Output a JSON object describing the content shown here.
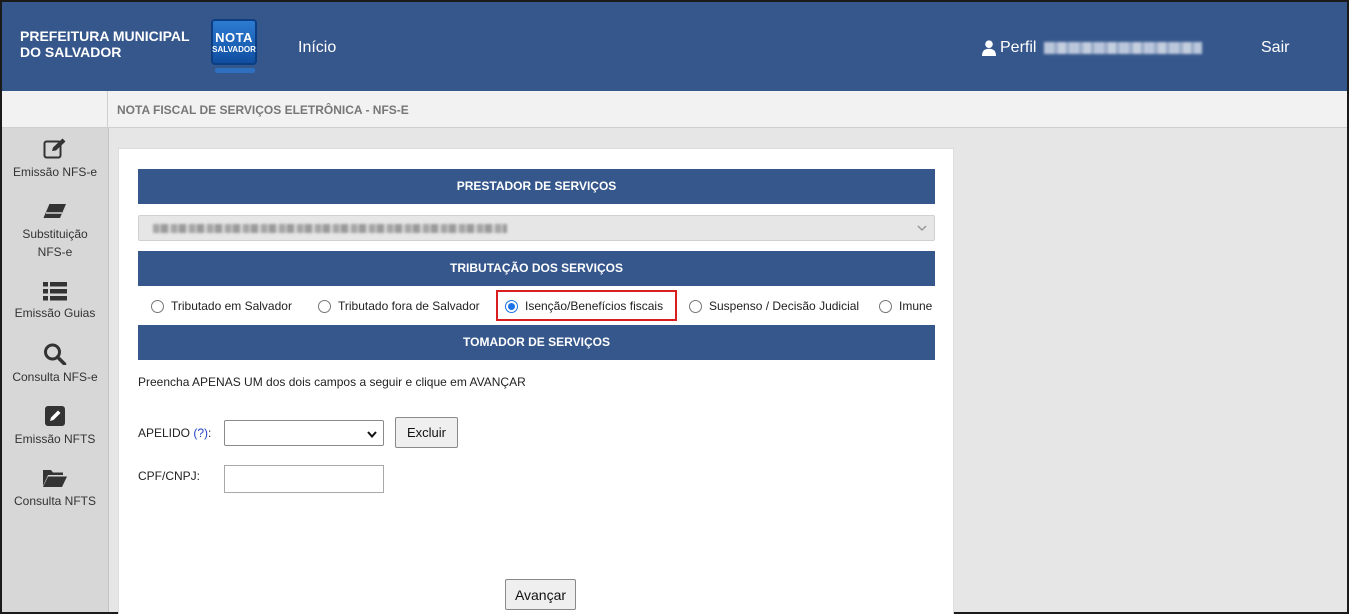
{
  "header": {
    "brand": "PREFEITURA MUNICIPAL DO SALVADOR",
    "logo_line1": "NOTA",
    "logo_line2": "SALVADOR",
    "nav_home": "Início",
    "profile_label": "Perfil",
    "logout": "Sair"
  },
  "breadcrumb": "NOTA FISCAL DE SERVIÇOS ELETRÔNICA - NFS-E",
  "sidebar": {
    "items": [
      {
        "label": "Emissão NFS-e",
        "icon": "edit-icon"
      },
      {
        "label": "Substituição NFS-e",
        "icon": "eraser-icon"
      },
      {
        "label": "Emissão Guias",
        "icon": "list-icon"
      },
      {
        "label": "Consulta NFS-e",
        "icon": "search-icon"
      },
      {
        "label": "Emissão NFTS",
        "icon": "pencil-square-icon"
      },
      {
        "label": "Consulta NFTS",
        "icon": "folder-open-icon"
      }
    ]
  },
  "form": {
    "prestador_title": "PRESTADOR DE SERVIÇOS",
    "tributacao_title": "TRIBUTAÇÃO DOS SERVIÇOS",
    "tributacao_options": [
      {
        "label": "Tributado em Salvador",
        "checked": false
      },
      {
        "label": "Tributado fora de Salvador",
        "checked": false
      },
      {
        "label": "Isenção/Benefícios fiscais",
        "checked": true
      },
      {
        "label": "Suspenso / Decisão Judicial",
        "checked": false
      },
      {
        "label": "Imune",
        "checked": false
      }
    ],
    "tomador_title": "TOMADOR DE SERVIÇOS",
    "instruction": "Preencha APENAS UM dos dois campos a seguir e clique em AVANÇAR",
    "apelido_label": "APELIDO",
    "apelido_help": "(?)",
    "apelido_colon": ":",
    "apelido_value": "",
    "delete_button": "Excluir",
    "cpf_label": "CPF/CNPJ:",
    "cpf_value": "",
    "next_button": "Avançar"
  },
  "colors": {
    "primary": "#36578c",
    "highlight": "#d81e1e",
    "radio_selected": "#1a73e8"
  }
}
